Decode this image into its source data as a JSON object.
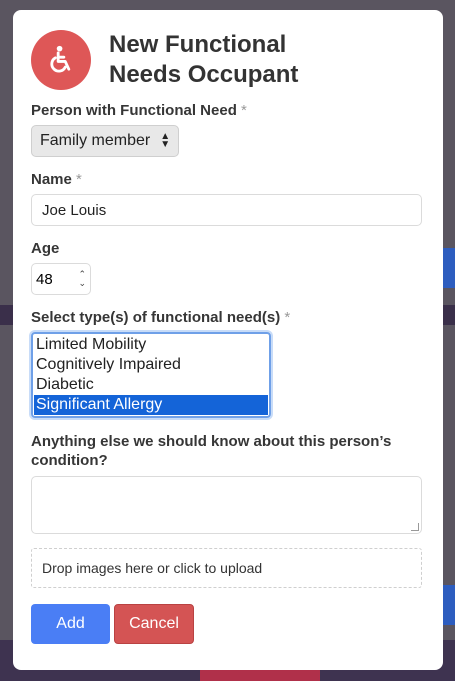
{
  "modal": {
    "title": "New Functional\nNeeds Occupant",
    "icon": "wheelchair-icon",
    "accent_color": "#de5757"
  },
  "person_field": {
    "label": "Person with Functional Need",
    "required_mark": "*",
    "selected": "Family member"
  },
  "name_field": {
    "label": "Name",
    "required_mark": "*",
    "value": "Joe Louis"
  },
  "age_field": {
    "label": "Age",
    "value": "48"
  },
  "needs_field": {
    "label": "Select type(s) of functional need(s)",
    "required_mark": "*",
    "options": [
      "Limited Mobility",
      "Cognitively Impaired",
      "Diabetic",
      "Significant Allergy"
    ],
    "selected": "Significant Allergy"
  },
  "condition_field": {
    "label": "Anything else we should know about this person’s condition?",
    "value": ""
  },
  "upload": {
    "label": "Drop images here or click to upload"
  },
  "actions": {
    "add_label": "Add",
    "cancel_label": "Cancel",
    "add_color": "#4a7ef5",
    "cancel_color": "#d45454"
  }
}
